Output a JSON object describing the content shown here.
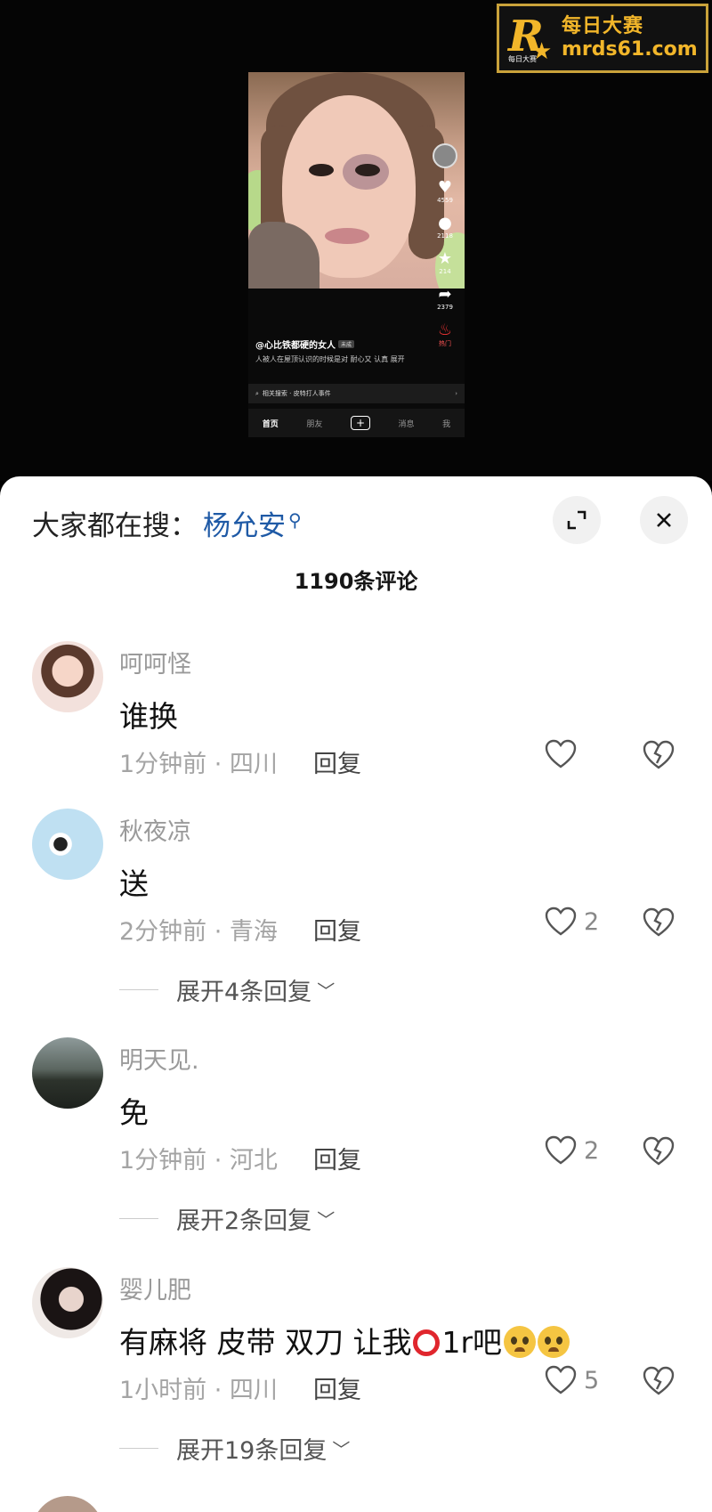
{
  "watermark": {
    "brand_cn": "每日大赛",
    "url": "mrds61.com",
    "logo_letter": "R",
    "logo_small": "每日大赛"
  },
  "video": {
    "side_counts": {
      "likes": "4559",
      "comments": "2118",
      "favorites": "214",
      "shares": "2379"
    },
    "author": "@心比铁都硬的女人",
    "author_tag": "未成",
    "description": "人被人在屋顶认识的时候是对 耐心又 认真 展开",
    "related_search": "相关搜索 · 皮特打人事件",
    "nav": {
      "home": "首页",
      "friends": "朋友",
      "messages": "消息",
      "me": "我"
    },
    "hot_label": "热门"
  },
  "sheet": {
    "search_prefix": "大家都在搜：",
    "search_keyword": "杨允安",
    "comment_count": "1190条评论"
  },
  "comments": [
    {
      "user": "呵呵怪",
      "text": "谁换",
      "meta": "1分钟前 · 四川",
      "reply": "回复",
      "likes": "",
      "expand": ""
    },
    {
      "user": "秋夜凉",
      "text": "送",
      "meta": "2分钟前 · 青海",
      "reply": "回复",
      "likes": "2",
      "expand": "展开4条回复"
    },
    {
      "user": "明天见.",
      "text": "免",
      "meta": "1分钟前 · 河北",
      "reply": "回复",
      "likes": "2",
      "expand": "展开2条回复"
    },
    {
      "user": "婴儿肥",
      "text_before": "有麻将 皮带 双刀 让我",
      "text_after": "1r吧",
      "meta": "1小时前 · 四川",
      "reply": "回复",
      "likes": "5",
      "expand": "展开19条回复"
    }
  ],
  "icons": [
    "expand-icon",
    "close-icon",
    "heart-icon",
    "broken-heart-icon",
    "chevron-down-icon",
    "search-icon",
    "pleading-face-emoji",
    "red-circle-emoji"
  ],
  "colors": {
    "keyword_blue": "#1f5aa6",
    "watermark_gold": "#f2b62a",
    "sheet_bg": "#ffffff"
  }
}
